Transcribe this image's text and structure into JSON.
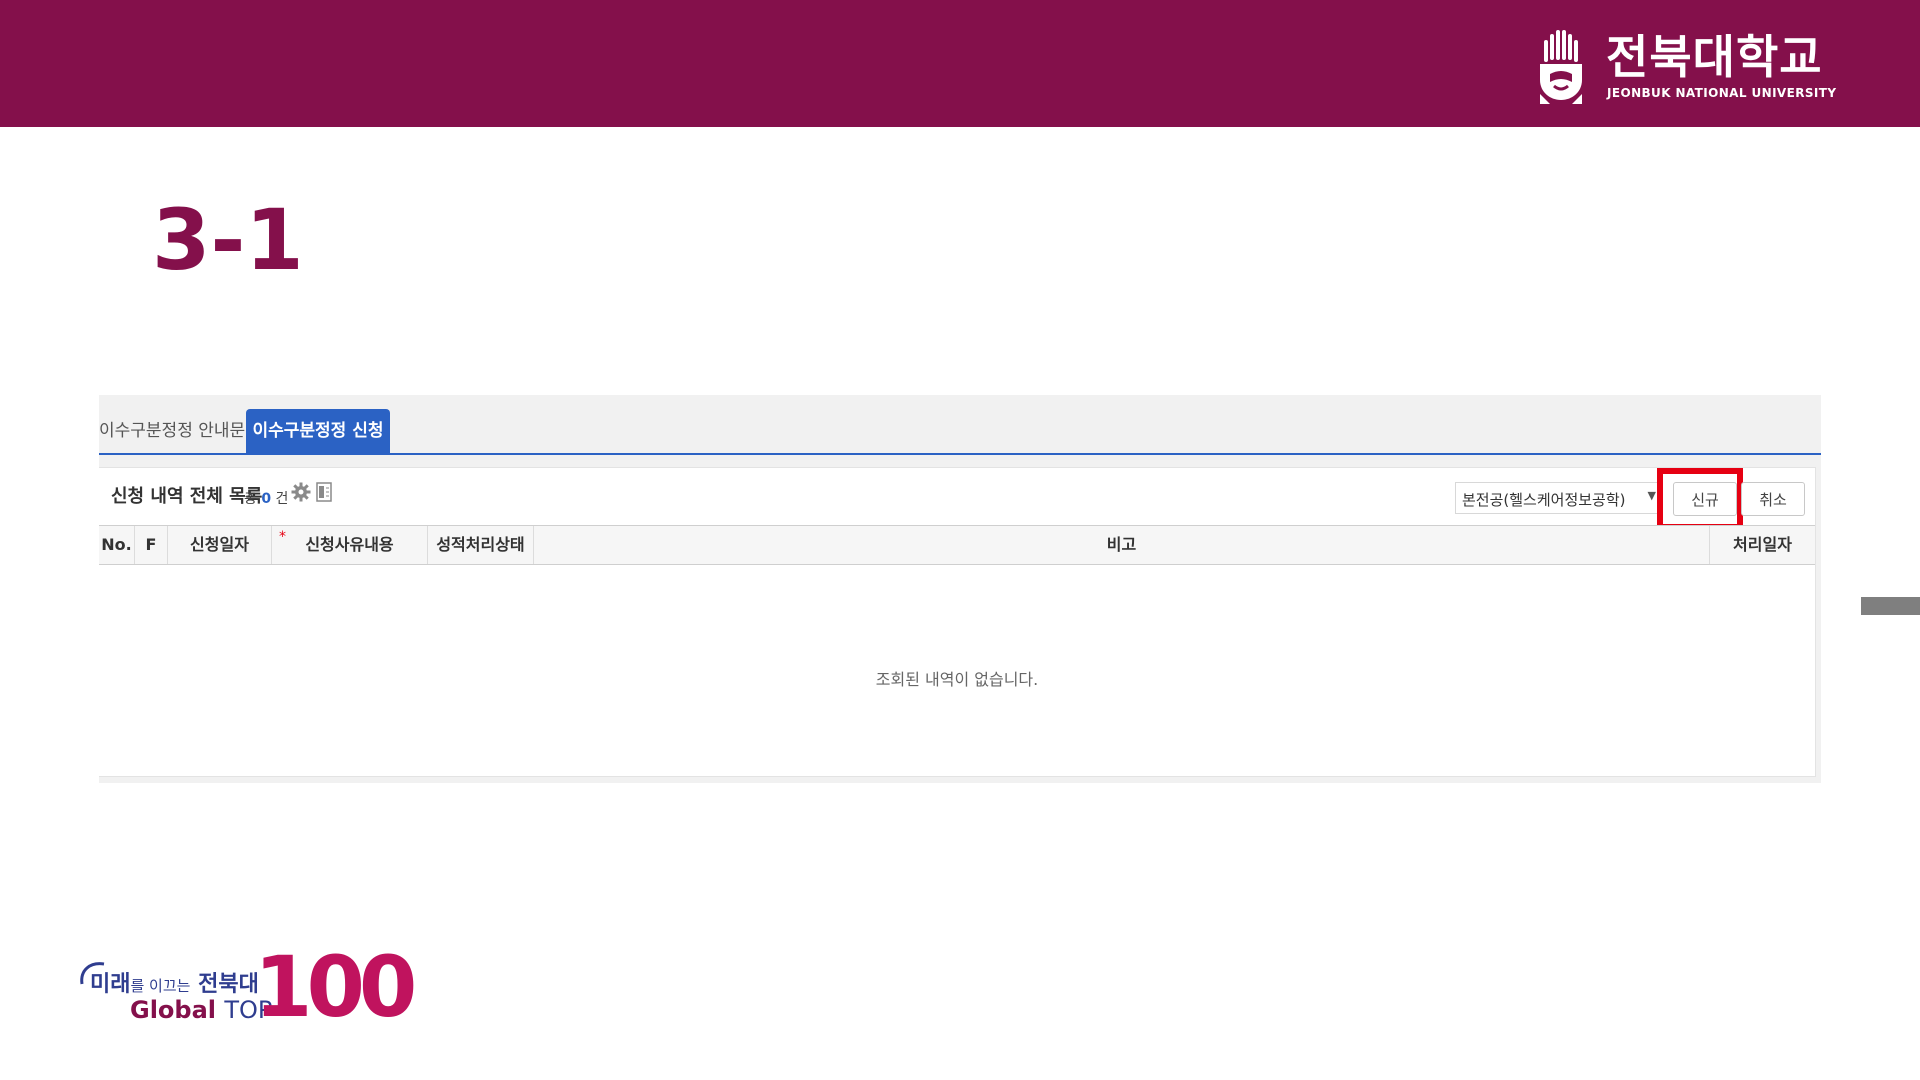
{
  "header": {
    "logo_name": "전북대학교",
    "logo_subtitle": "JEONBUK NATIONAL UNIVERSITY",
    "brand_color": "#84104b"
  },
  "slide": {
    "title": "3-1"
  },
  "tabs": [
    {
      "label": "이수구분정정 안내문",
      "active": false
    },
    {
      "label": "이수구분정정 신청",
      "active": true
    }
  ],
  "list": {
    "title": "신청 내역 전체 목록",
    "count_prefix": "총",
    "count": "0",
    "count_suffix": "건"
  },
  "major_select": {
    "value": "본전공(헬스케어정보공학)"
  },
  "buttons": {
    "new": "신규",
    "cancel": "취소"
  },
  "table": {
    "columns": [
      "No.",
      "F",
      "신청일자",
      "신청사유내용",
      "성적처리상태",
      "비고",
      "처리일자"
    ],
    "required_mark": "*",
    "empty_message": "조회된 내역이 없습니다."
  },
  "footer_logo": {
    "line1_a": "미래",
    "line1_b": "를 이끄는",
    "line1_c": "전북대",
    "global": "Global",
    "top": "TOP",
    "number": "100"
  },
  "colors": {
    "accent_blue": "#2b62c4",
    "highlight_red": "#e60012"
  }
}
